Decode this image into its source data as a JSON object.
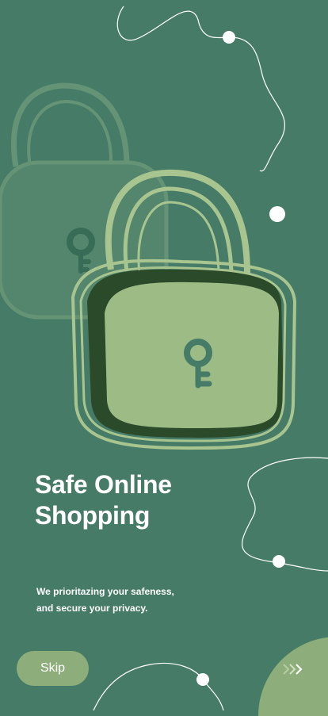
{
  "onboarding": {
    "title_line1": "Safe Online",
    "title_line2": "Shopping",
    "subtitle_line1": "We prioritazing your safeness,",
    "subtitle_line2": "and secure your privacy."
  },
  "actions": {
    "skip_label": "Skip",
    "next_icon": "triple-chevron-right-icon"
  },
  "colors": {
    "background": "#467C67",
    "accent": "#8DAE7B",
    "lock_body": "#9DBB84",
    "lock_shadow": "#2B4A2A",
    "text": "#FFFFFF"
  }
}
